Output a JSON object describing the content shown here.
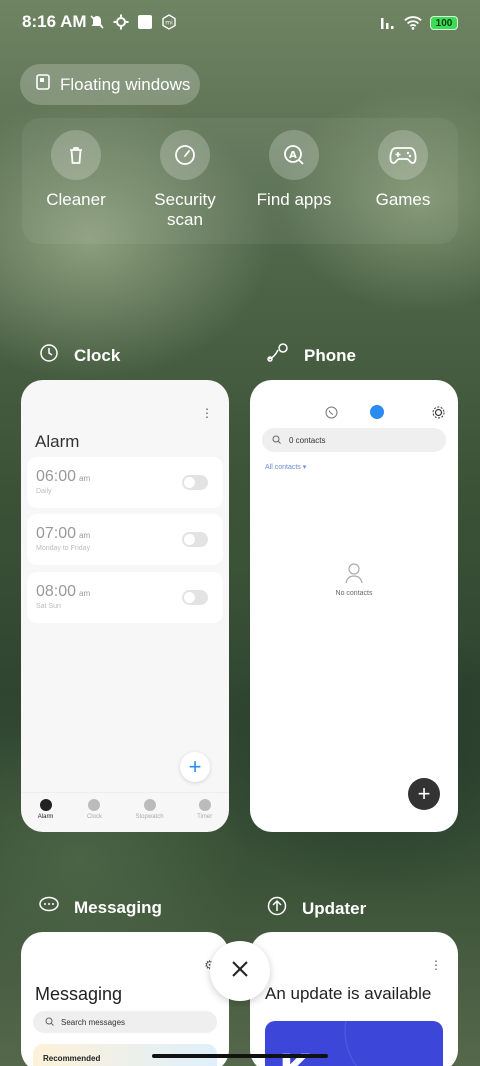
{
  "status_bar": {
    "time": "8:16 AM",
    "battery": "100"
  },
  "floating_windows": {
    "label": "Floating windows"
  },
  "quick_actions": [
    {
      "label": "Cleaner",
      "icon": "trash-icon"
    },
    {
      "label": "Security scan",
      "icon": "security-icon"
    },
    {
      "label": "Find apps",
      "icon": "find-apps-icon"
    },
    {
      "label": "Games",
      "icon": "gamepad-icon"
    }
  ],
  "apps": {
    "clock": {
      "name": "Clock",
      "title": "Alarm",
      "alarms": [
        {
          "time": "06:00",
          "ampm": "am",
          "repeat": "Daily"
        },
        {
          "time": "07:00",
          "ampm": "am",
          "repeat": "Monday to Friday"
        },
        {
          "time": "08:00",
          "ampm": "am",
          "repeat": "Sat Sun"
        }
      ],
      "tabs": [
        "Alarm",
        "Clock",
        "Stopwatch",
        "Timer"
      ]
    },
    "phone": {
      "name": "Phone",
      "search_placeholder": "0 contacts",
      "all_contacts": "All contacts",
      "empty": "No contacts"
    },
    "messaging": {
      "name": "Messaging",
      "title": "Messaging",
      "search_placeholder": "Search messages",
      "recommended": "Recommended"
    },
    "updater": {
      "name": "Updater",
      "title": "An update is available"
    }
  },
  "colors": {
    "accent_blue": "#2a8cf0",
    "battery_green": "#3ddc55"
  }
}
